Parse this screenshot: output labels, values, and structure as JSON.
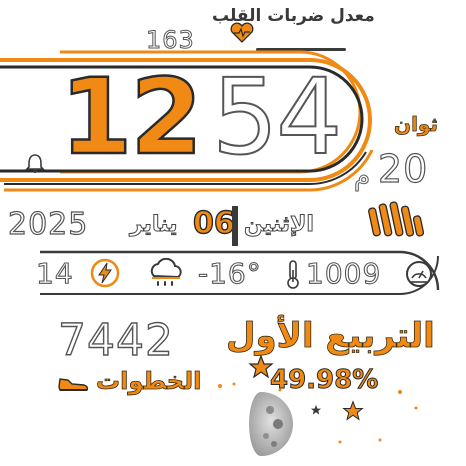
{
  "colors": {
    "accent": "#f08a14",
    "text": "#3a3a3a",
    "outline": "#555555"
  },
  "heart": {
    "label": "معدل ضربات القلب",
    "value": "163",
    "icon": "heart-icon"
  },
  "time": {
    "hours": "12",
    "minutes": "54",
    "seconds_label": "ثوان",
    "seconds": "20",
    "ampm": "م"
  },
  "alarm": {
    "icon": "bell-icon"
  },
  "date": {
    "year": "2025",
    "month": "يناير",
    "day": "06",
    "weekday": "الإثنين"
  },
  "battery": {
    "value": "14",
    "icon": "lightning-icon"
  },
  "weather": {
    "icon": "rain-cloud-icon",
    "temperature": "-16°",
    "thermo_icon": "thermometer-icon"
  },
  "pressure": {
    "value": "1009",
    "icon": "gauge-icon"
  },
  "steps": {
    "value": "7442",
    "label": "الخطوات",
    "icon": "shoe-icon"
  },
  "moon": {
    "phase_label": "التربيع الأول",
    "illumination": "49.98%",
    "icon": "moon-icon",
    "star_icon": "star-icon"
  }
}
